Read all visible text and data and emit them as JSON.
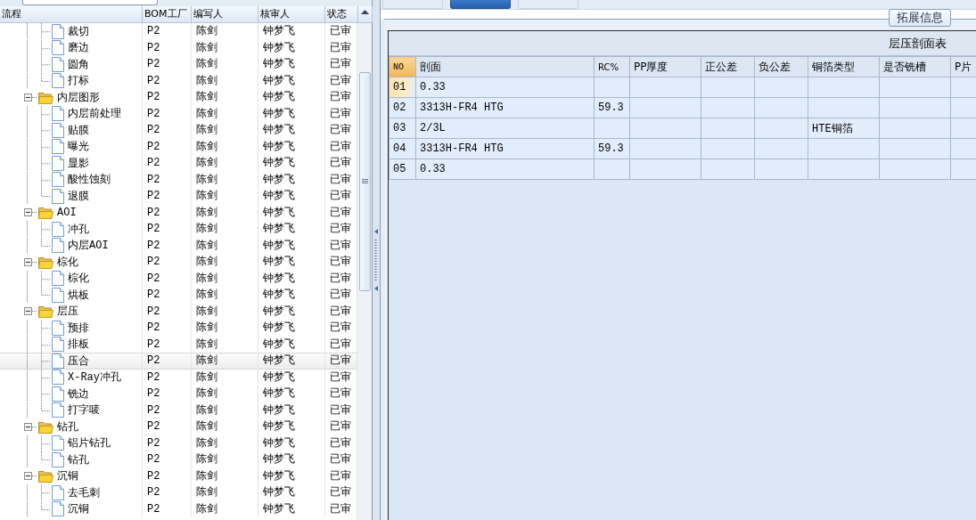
{
  "tree": {
    "columns": [
      "流程",
      "BOM工厂",
      "编写人",
      "核审人",
      "状态"
    ],
    "nodes": [
      {
        "children": [
          {
            "label": "裁切",
            "selected": false,
            "cells": [
              "P2",
              "陈剑",
              "钟梦飞",
              "已审"
            ]
          },
          {
            "label": "磨边",
            "selected": false,
            "cells": [
              "P2",
              "陈剑",
              "钟梦飞",
              "已审"
            ]
          },
          {
            "label": "圆角",
            "selected": false,
            "cells": [
              "P2",
              "陈剑",
              "钟梦飞",
              "已审"
            ]
          },
          {
            "label": "打标",
            "selected": false,
            "cells": [
              "P2",
              "陈剑",
              "钟梦飞",
              "已审"
            ]
          }
        ]
      },
      {
        "label": "内层图形",
        "selected": false,
        "expanded": true,
        "cells": [
          "P2",
          "陈剑",
          "钟梦飞",
          "已审"
        ],
        "children": [
          {
            "label": "内层前处理",
            "selected": false,
            "cells": [
              "P2",
              "陈剑",
              "钟梦飞",
              "已审"
            ]
          },
          {
            "label": "贴膜",
            "selected": false,
            "cells": [
              "P2",
              "陈剑",
              "钟梦飞",
              "已审"
            ]
          },
          {
            "label": "曝光",
            "selected": false,
            "cells": [
              "P2",
              "陈剑",
              "钟梦飞",
              "已审"
            ]
          },
          {
            "label": "显影",
            "selected": false,
            "cells": [
              "P2",
              "陈剑",
              "钟梦飞",
              "已审"
            ]
          },
          {
            "label": "酸性蚀刻",
            "selected": false,
            "cells": [
              "P2",
              "陈剑",
              "钟梦飞",
              "已审"
            ]
          },
          {
            "label": "退膜",
            "selected": false,
            "cells": [
              "P2",
              "陈剑",
              "钟梦飞",
              "已审"
            ]
          }
        ]
      },
      {
        "label": "AOI",
        "selected": false,
        "expanded": true,
        "cells": [
          "P2",
          "陈剑",
          "钟梦飞",
          "已审"
        ],
        "children": [
          {
            "label": "冲孔",
            "selected": false,
            "cells": [
              "P2",
              "陈剑",
              "钟梦飞",
              "已审"
            ]
          },
          {
            "label": "内层AOI",
            "selected": false,
            "cells": [
              "P2",
              "陈剑",
              "钟梦飞",
              "已审"
            ]
          }
        ]
      },
      {
        "label": "棕化",
        "selected": false,
        "expanded": true,
        "cells": [
          "P2",
          "陈剑",
          "钟梦飞",
          "已审"
        ],
        "children": [
          {
            "label": "棕化",
            "selected": false,
            "cells": [
              "P2",
              "陈剑",
              "钟梦飞",
              "已审"
            ]
          },
          {
            "label": "烘板",
            "selected": false,
            "cells": [
              "P2",
              "陈剑",
              "钟梦飞",
              "已审"
            ]
          }
        ]
      },
      {
        "label": "层压",
        "selected": false,
        "expanded": true,
        "cells": [
          "P2",
          "陈剑",
          "钟梦飞",
          "已审"
        ],
        "children": [
          {
            "label": "预排",
            "selected": false,
            "cells": [
              "P2",
              "陈剑",
              "钟梦飞",
              "已审"
            ]
          },
          {
            "label": "排板",
            "selected": false,
            "cells": [
              "P2",
              "陈剑",
              "钟梦飞",
              "已审"
            ]
          },
          {
            "label": "压合",
            "selected": true,
            "cells": [
              "P2",
              "陈剑",
              "钟梦飞",
              "已审"
            ]
          },
          {
            "label": "X-Ray冲孔",
            "selected": false,
            "cells": [
              "P2",
              "陈剑",
              "钟梦飞",
              "已审"
            ]
          },
          {
            "label": "铣边",
            "selected": false,
            "cells": [
              "P2",
              "陈剑",
              "钟梦飞",
              "已审"
            ]
          },
          {
            "label": "打字唛",
            "selected": false,
            "cells": [
              "P2",
              "陈剑",
              "钟梦飞",
              "已审"
            ]
          }
        ]
      },
      {
        "label": "钻孔",
        "selected": false,
        "expanded": true,
        "cells": [
          "P2",
          "陈剑",
          "钟梦飞",
          "已审"
        ],
        "children": [
          {
            "label": "铝片钻孔",
            "selected": false,
            "cells": [
              "P2",
              "陈剑",
              "钟梦飞",
              "已审"
            ]
          },
          {
            "label": "钻孔",
            "selected": false,
            "cells": [
              "P2",
              "陈剑",
              "钟梦飞",
              "已审"
            ]
          }
        ]
      },
      {
        "label": "沉铜",
        "selected": false,
        "expanded": true,
        "cells": [
          "P2",
          "陈剑",
          "钟梦飞",
          "已审"
        ],
        "children": [
          {
            "label": "去毛刺",
            "selected": false,
            "cells": [
              "P2",
              "陈剑",
              "钟梦飞",
              "已审"
            ]
          },
          {
            "label": "沉铜",
            "selected": false,
            "cells": [
              "P2",
              "陈剑",
              "钟梦飞",
              "已审"
            ]
          }
        ]
      }
    ]
  },
  "tabs": [
    {
      "selected": false
    },
    {
      "selected": true
    },
    {
      "selected": false
    }
  ],
  "group": {
    "title": "拓展信息"
  },
  "table": {
    "title": "层压剖面表",
    "columns": [
      "NO",
      "剖面",
      "RC%",
      "PP厚度",
      "正公差",
      "负公差",
      "铜箔类型",
      "是否铣槽",
      "P片"
    ],
    "rows": [
      {
        "selected": true,
        "cells": [
          "01",
          "0.33",
          "",
          "",
          "",
          "",
          "",
          "",
          ""
        ]
      },
      {
        "selected": false,
        "cells": [
          "02",
          "3313H-FR4 HTG",
          "59.3",
          "",
          "",
          "",
          "",
          "",
          ""
        ]
      },
      {
        "selected": false,
        "cells": [
          "03",
          "2/3L",
          "",
          "",
          "",
          "",
          "HTE铜箔",
          "",
          ""
        ]
      },
      {
        "selected": false,
        "cells": [
          "04",
          "3313H-FR4 HTG",
          "59.3",
          "",
          "",
          "",
          "",
          "",
          ""
        ]
      },
      {
        "selected": false,
        "cells": [
          "05",
          "0.33",
          "",
          "",
          "",
          "",
          "",
          "",
          ""
        ]
      }
    ]
  }
}
